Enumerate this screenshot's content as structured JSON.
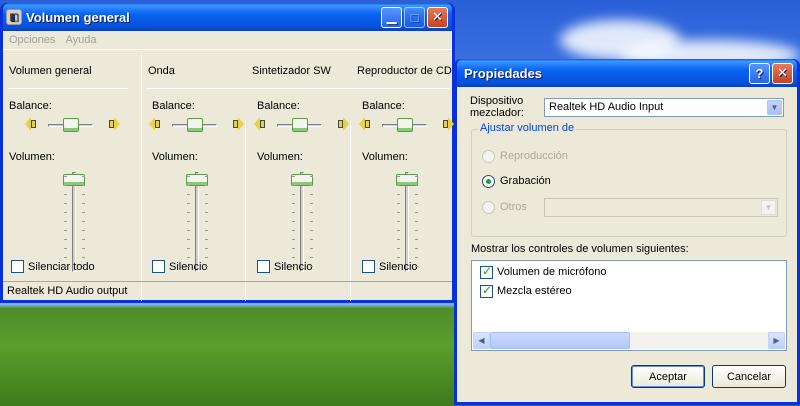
{
  "volume_window": {
    "title": "Volumen general",
    "menu": [
      "Opciones",
      "Ayuda"
    ],
    "columns": [
      {
        "title": "Volumen general",
        "balance_label": "Balance:",
        "volume_label": "Volumen:",
        "mute_label": "Silenciar todo",
        "muted": false
      },
      {
        "title": "Onda",
        "balance_label": "Balance:",
        "volume_label": "Volumen:",
        "mute_label": "Silencio",
        "muted": false
      },
      {
        "title": "Sintetizador SW",
        "balance_label": "Balance:",
        "volume_label": "Volumen:",
        "mute_label": "Silencio",
        "muted": false
      },
      {
        "title": "Reproductor de CD",
        "balance_label": "Balance:",
        "volume_label": "Volumen:",
        "mute_label": "Silencio",
        "muted": false
      }
    ],
    "status": "Realtek HD Audio output"
  },
  "properties_dialog": {
    "title": "Propiedades",
    "mixer_label": "Dispositivo\nmezclador:",
    "mixer_value": "Realtek HD Audio Input",
    "adjust_group": "Ajustar volumen de",
    "options": [
      {
        "label": "Reproducción",
        "selected": false,
        "enabled": false
      },
      {
        "label": "Grabación",
        "selected": true,
        "enabled": true
      },
      {
        "label": "Otros",
        "selected": false,
        "enabled": false
      }
    ],
    "show_controls_label": "Mostrar los controles de volumen siguientes:",
    "controls": [
      {
        "label": "Volumen de micrófono",
        "checked": true
      },
      {
        "label": "Mezcla estéreo",
        "checked": true
      }
    ],
    "ok_label": "Aceptar",
    "cancel_label": "Cancelar"
  },
  "colors": {
    "titlebar": "#0a5ce6",
    "client": "#ece9d8",
    "slider_thumb": "#8bc87a"
  }
}
